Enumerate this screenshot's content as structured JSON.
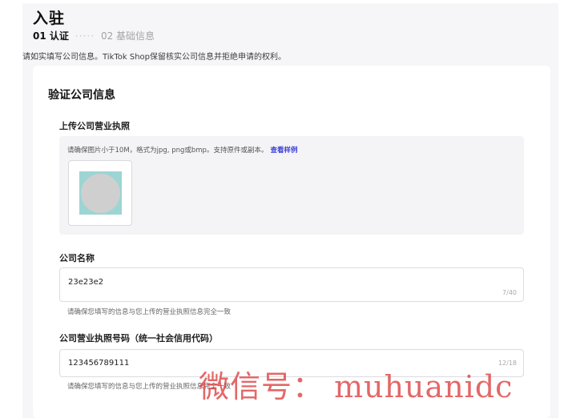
{
  "page": {
    "title": "入驻",
    "steps": {
      "active": "01 认证",
      "separator": "·····",
      "inactive": "02 基础信息"
    },
    "notice": "请如实填写公司信息。TikTok Shop保留核实公司信息并拒绝申请的权利。"
  },
  "verify_section": {
    "title": "验证公司信息",
    "license_upload": {
      "label": "上传公司营业执照",
      "hint": "请确保图片小于10M，格式为jpg, png或bmp。支持原件或副本。",
      "sample_link": "查看样例"
    },
    "company_name": {
      "label": "公司名称",
      "value": "23e23e2",
      "counter": "7/40",
      "hint": "请确保您填写的信息与您上传的营业执照信息完全一致"
    },
    "license_number": {
      "label": "公司营业执照号码（统一社会信用代码）",
      "value": "123456789111",
      "counter": "12/18",
      "hint": "请确保您填写的信息与您上传的营业执照信息完全一致"
    }
  },
  "watermark": "微信号： muhuanidc",
  "colors": {
    "background": "#f6f6f8",
    "card": "#ffffff",
    "link": "#3b3fd8",
    "watermark": "#dc3c3c"
  }
}
